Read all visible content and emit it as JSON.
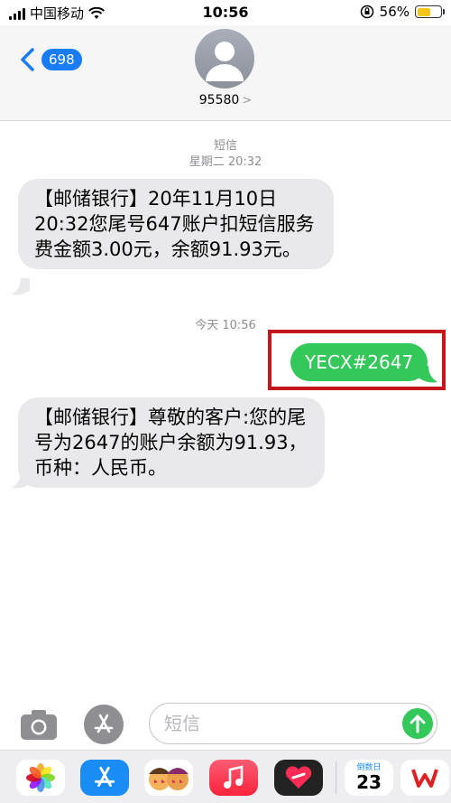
{
  "status_bar": {
    "carrier": "中国移动",
    "time": "10:56",
    "battery_percent": "56%",
    "battery_level": 0.56
  },
  "header": {
    "back_count": "698",
    "contact_number": "95580",
    "contact_chevron": ">"
  },
  "thread": {
    "ts1_label": "短信",
    "ts1_time": "星期二 20:32",
    "msg1": "【邮储银行】20年11月10日20:32您尾号647账户扣短信服务费金额3.00元，余额91.93元。",
    "ts2_time": "今天 10:56",
    "msg2": "YECX#2647",
    "msg3": "【邮储银行】尊敬的客户:您的尾号为2647的账户余额为91.93，币种：人民币。"
  },
  "input": {
    "placeholder": "短信"
  },
  "drawer": {
    "date_label": "倒数日",
    "date_num": "23"
  },
  "colors": {
    "accent_blue": "#1a7cf5",
    "sent_green": "#34c759",
    "received_gray": "#e9e9eb",
    "highlight_red": "#c3171d"
  }
}
